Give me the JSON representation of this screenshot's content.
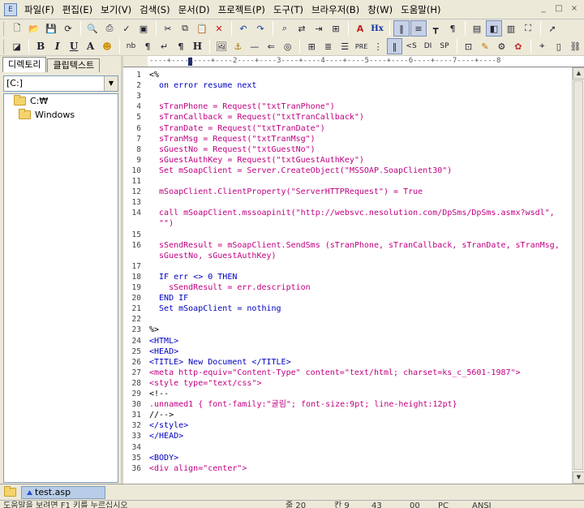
{
  "menu": {
    "items": [
      "파일(F)",
      "편집(E)",
      "보기(V)",
      "검색(S)",
      "문서(D)",
      "프로젝트(P)",
      "도구(T)",
      "브라우저(B)",
      "창(W)",
      "도움말(H)"
    ],
    "window_controls": [
      "_",
      "□",
      "×"
    ]
  },
  "toolbar2": {
    "bold": "B",
    "italic": "I",
    "underline": "U",
    "font": "A",
    "nbsp": "nb",
    "hx": "Hx",
    "tag_s": "<S",
    "tag_di": "DI",
    "tag_sp": "SP"
  },
  "left_panel": {
    "tabs": [
      "디렉토리",
      "클립텍스트"
    ],
    "drive": "[C:]",
    "tree": [
      "C:₩",
      "Windows"
    ]
  },
  "ruler": {
    "text": "----+----1----+----2----+----3----+----4----+----5----+----6----+----7----+----8"
  },
  "editor": {
    "lines": [
      {
        "n": "1",
        "t": "<%",
        "c": "o"
      },
      {
        "n": "2",
        "t": "  on error resume next",
        "c": "k"
      },
      {
        "n": "3",
        "t": "",
        "c": "o"
      },
      {
        "n": "4",
        "t": "  sTranPhone = Request(\"txtTranPhone\")",
        "c": "s"
      },
      {
        "n": "5",
        "t": "  sTranCallback = Request(\"txtTranCallback\")",
        "c": "s"
      },
      {
        "n": "6",
        "t": "  sTranDate = Request(\"txtTranDate\")",
        "c": "s"
      },
      {
        "n": "7",
        "t": "  sTranMsg = Request(\"txtTranMsg\")",
        "c": "s"
      },
      {
        "n": "8",
        "t": "  sGuestNo = Request(\"txtGuestNo\")",
        "c": "s"
      },
      {
        "n": "9",
        "t": "  sGuestAuthKey = Request(\"txtGuestAuthKey\")",
        "c": "s"
      },
      {
        "n": "10",
        "t": "  Set mSoapClient = Server.CreateObject(\"MSSOAP.SoapClient30\")",
        "c": "s"
      },
      {
        "n": "11",
        "t": "",
        "c": "o"
      },
      {
        "n": "12",
        "t": "  mSoapClient.ClientProperty(\"ServerHTTPRequest\") = True",
        "c": "s"
      },
      {
        "n": "13",
        "t": "",
        "c": "o"
      },
      {
        "n": "14",
        "t": "  call mSoapClient.mssoapinit(\"http://websvc.nesolution.com/DpSms/DpSms.asmx?wsdl\",",
        "c": "s"
      },
      {
        "n": "",
        "t": "  \"\")",
        "c": "s"
      },
      {
        "n": "15",
        "t": "",
        "c": "o"
      },
      {
        "n": "16",
        "t": "  sSendResult = mSoapClient.SendSms (sTranPhone, sTranCallback, sTranDate, sTranMsg,",
        "c": "s"
      },
      {
        "n": "",
        "t": "  sGuestNo, sGuestAuthKey)",
        "c": "s"
      },
      {
        "n": "17",
        "t": "",
        "c": "o"
      },
      {
        "n": "18",
        "t": "  IF err <> 0 THEN",
        "c": "k"
      },
      {
        "n": "19",
        "t": "    sSendResult = err.description",
        "c": "s"
      },
      {
        "n": "20",
        "t": "  END IF",
        "c": "k"
      },
      {
        "n": "21",
        "t": "  Set mSoapClient = nothing",
        "c": "k"
      },
      {
        "n": "22",
        "t": "",
        "c": "o"
      },
      {
        "n": "23",
        "t": "%>",
        "c": "o"
      },
      {
        "n": "24",
        "t": "<HTML>",
        "c": "k"
      },
      {
        "n": "25",
        "t": "<HEAD>",
        "c": "k"
      },
      {
        "n": "26",
        "t": "<TITLE> New Document </TITLE>",
        "c": "k"
      },
      {
        "n": "27",
        "t": "<meta http-equiv=\"Content-Type\" content=\"text/html; charset=ks_c_5601-1987\">",
        "c": "s"
      },
      {
        "n": "28",
        "t": "<style type=\"text/css\">",
        "c": "s"
      },
      {
        "n": "29",
        "t": "<!--",
        "c": "o"
      },
      {
        "n": "30",
        "t": ".unnamed1 { font-family:\"굴림\"; font-size:9pt; line-height:12pt}",
        "c": "s"
      },
      {
        "n": "31",
        "t": "//-->",
        "c": "o"
      },
      {
        "n": "32",
        "t": "</style>",
        "c": "k"
      },
      {
        "n": "33",
        "t": "</HEAD>",
        "c": "k"
      },
      {
        "n": "34",
        "t": "",
        "c": "o"
      },
      {
        "n": "35",
        "t": "<BODY>",
        "c": "k"
      },
      {
        "n": "36",
        "t": "<div align=\"center\">",
        "c": "s"
      }
    ]
  },
  "doc_tabs": {
    "active": "test.asp"
  },
  "status": {
    "items": [
      "도움말을 보려면 F1 키를 누르십시오",
      "줄 20",
      "칸 9",
      "43",
      "00",
      "PC",
      "ANSI"
    ]
  },
  "colors": {
    "keyword": "#0000c0",
    "string": "#c00080",
    "chrome": "#ece9d8"
  }
}
